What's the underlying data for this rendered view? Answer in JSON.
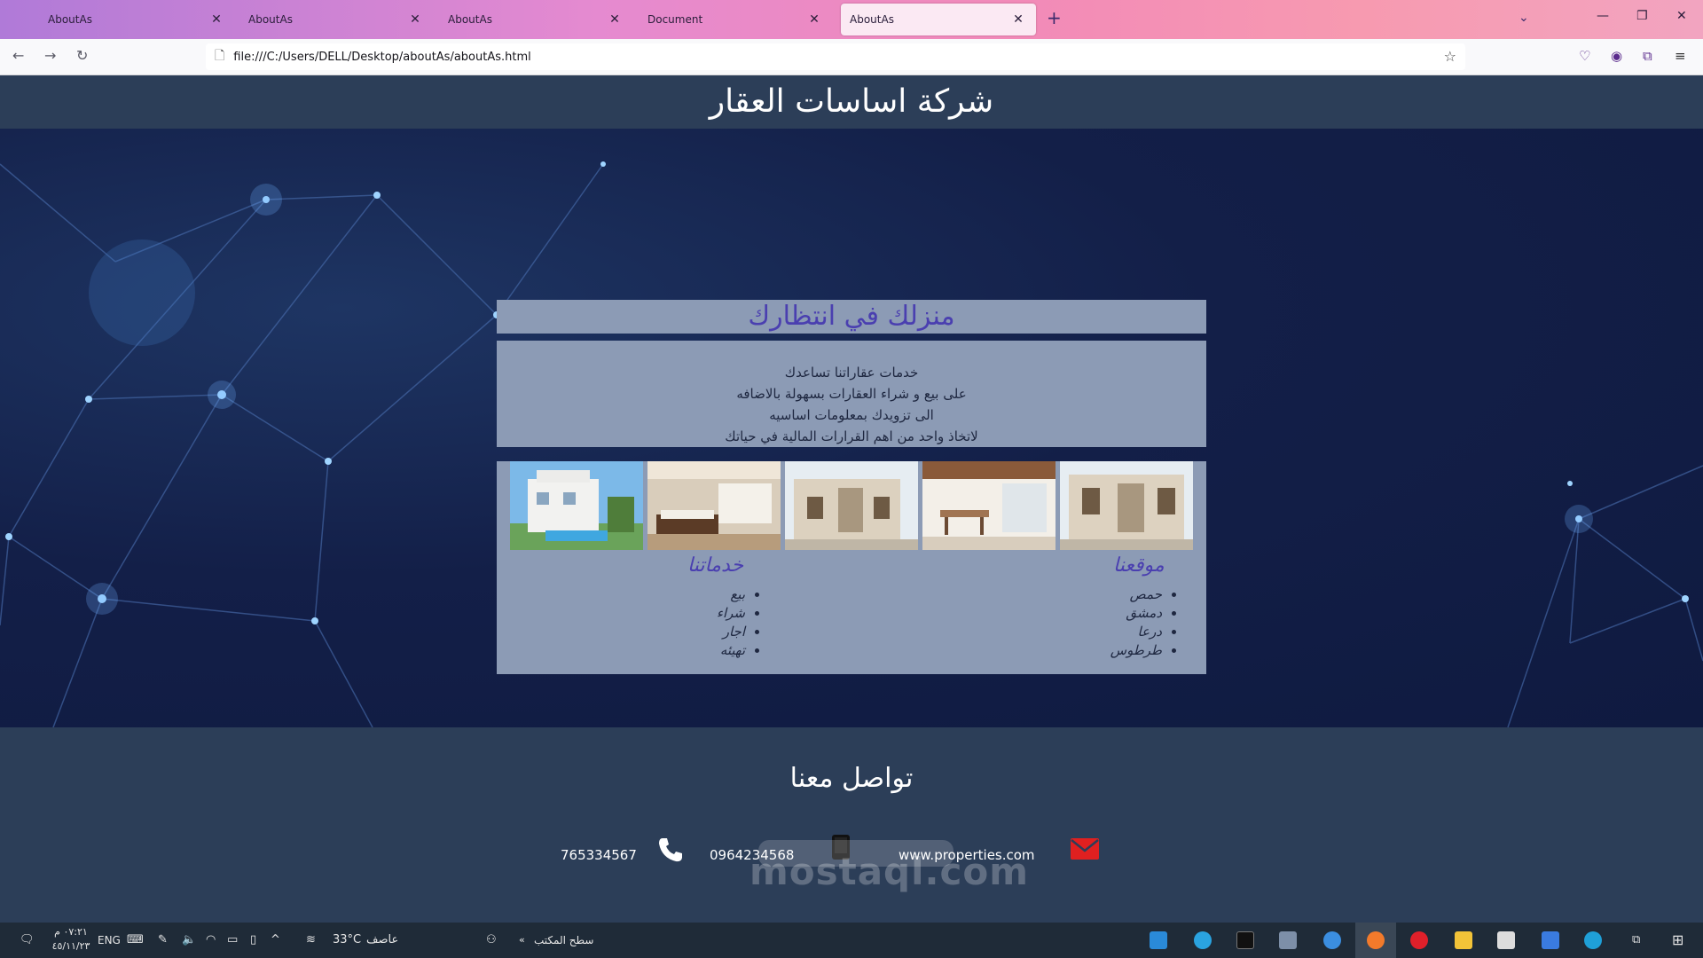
{
  "browser": {
    "tabs": [
      {
        "label": "AboutAs",
        "active": false
      },
      {
        "label": "AboutAs",
        "active": false
      },
      {
        "label": "AboutAs",
        "active": false
      },
      {
        "label": "Document",
        "active": false
      },
      {
        "label": "AboutAs",
        "active": true
      }
    ],
    "url": "file:///C:/Users/DELL/Desktop/aboutAs/aboutAs.html"
  },
  "site": {
    "header_title": "شركة اساسات العقار",
    "panel_title": "منزلك في انتظارك",
    "panel_lines": [
      "خدمات عقاراتنا تساعدك",
      "على بيع و شراء العقارات بسهولة بالاضافه",
      "الى تزويدك بمعلومات اساسيه",
      "لاتخاذ واحد من اهم القرارات المالية في حياتك"
    ],
    "locations": {
      "title": "موقعنا",
      "items": [
        "حمص",
        "دمشق",
        "درعا",
        "طرطوس"
      ]
    },
    "services": {
      "title": "خدماتنا",
      "items": [
        "بيع",
        "شراء",
        "اجار",
        "تهيئه"
      ]
    },
    "contact": {
      "title": "تواصل معنا",
      "phone1": "765334567",
      "phone2": "0964234568",
      "website": "www.properties.com"
    }
  },
  "watermark": {
    "latin": "mostaql.com"
  },
  "taskbar": {
    "time": "٠٧:٢١ م",
    "date": "٤٥/١١/٢٣",
    "lang": "ENG",
    "temperature": "33°C",
    "weather": "عاصف",
    "desktop_label": "سطح المكتب"
  }
}
